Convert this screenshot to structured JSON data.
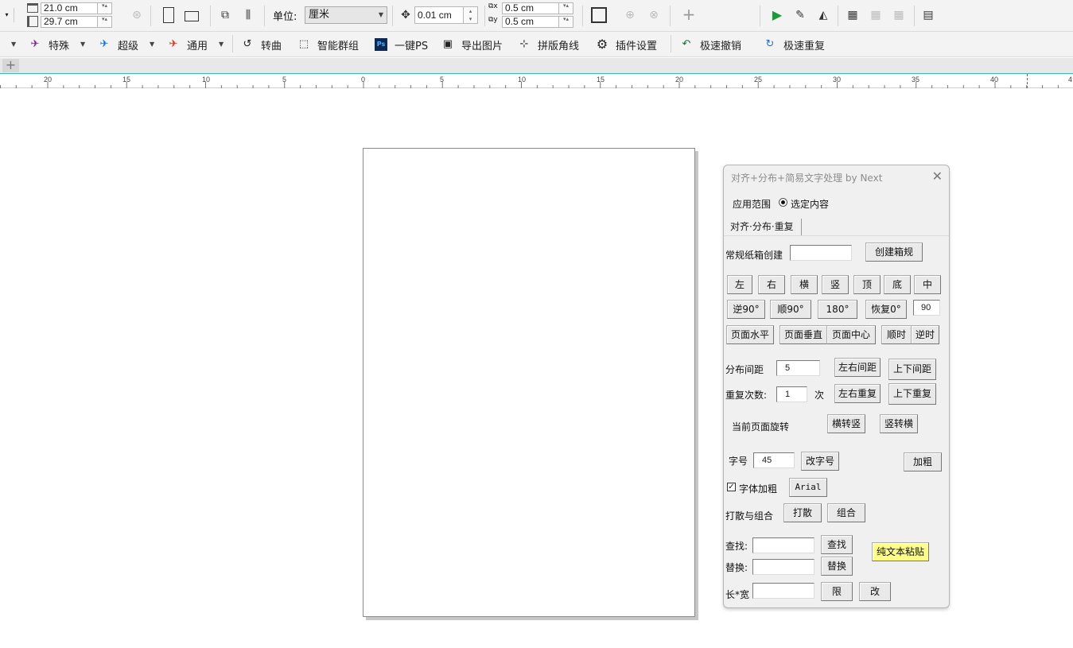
{
  "property_bar": {
    "width_value": "21.0 cm",
    "height_value": "29.7 cm",
    "units_label": "单位:",
    "units_value": "厘米",
    "nudge_value": "0.01 cm",
    "dup_x_value": "0.5 cm",
    "dup_y_value": "0.5 cm"
  },
  "command_bar": {
    "items": [
      {
        "label": "特殊"
      },
      {
        "label": "超级"
      },
      {
        "label": "通用"
      },
      {
        "label": "转曲"
      },
      {
        "label": "智能群组"
      },
      {
        "label": "一键PS"
      },
      {
        "label": "导出图片"
      },
      {
        "label": "拼版角线"
      },
      {
        "label": "插件设置"
      },
      {
        "label": "极速撤销"
      },
      {
        "label": "极速重复"
      }
    ]
  },
  "ruler": {
    "labels": [
      "20",
      "15",
      "10",
      "5",
      "0",
      "5",
      "10",
      "15",
      "20",
      "25",
      "30",
      "35",
      "40",
      "4"
    ]
  },
  "dialog": {
    "title": "对齐+分布+简易文字处理 by Next",
    "scope_label": "应用范围",
    "scope_option": "选定内容",
    "tab_label": "对齐·分布·重复",
    "box_label": "常规纸箱创建",
    "box_value": "",
    "create_box_button": "创建箱规",
    "align_buttons": [
      "左",
      "右",
      "横",
      "竖",
      "顶",
      "底",
      "中"
    ],
    "rotate_buttons": [
      "逆90°",
      "顺90°",
      "180°",
      "恢复0°"
    ],
    "rotate_angle_value": "90",
    "page_buttons": [
      "页面水平",
      "页面垂直",
      "页面中心",
      "顺时",
      "逆时"
    ],
    "spacing_label": "分布间距",
    "spacing_value": "5",
    "lr_spacing_button": "左右间距",
    "ud_spacing_button": "上下间距",
    "repeat_label": "重复次数:",
    "repeat_value": "1",
    "repeat_unit": "次",
    "lr_repeat_button": "左右重复",
    "ud_repeat_button": "上下重复",
    "page_rotate_label": "当前页面旋转",
    "h_to_v_button": "横转竖",
    "v_to_h_button": "竖转横",
    "font_size_label": "字号",
    "font_size_value": "45",
    "change_size_button": "改字号",
    "bold_button": "加粗",
    "bold_check_mark": "✓",
    "bold_check_label": "字体加粗",
    "font_button": "Arial",
    "break_group_label": "打散与组合",
    "break_button": "打散",
    "group_button": "组合",
    "find_label": "查找:",
    "find_value": "",
    "find_button": "查找",
    "replace_label": "替换:",
    "replace_value": "",
    "replace_button": "替换",
    "paste_button": "纯文本粘贴",
    "size_label": "长*宽",
    "size_value": "",
    "limit_button": "限",
    "change_button": "改"
  },
  "colors": {
    "ruler_top_line": "#3fb6ae",
    "paste_button_bg": "#ffff88",
    "run_icon": "#1a9c3a"
  }
}
